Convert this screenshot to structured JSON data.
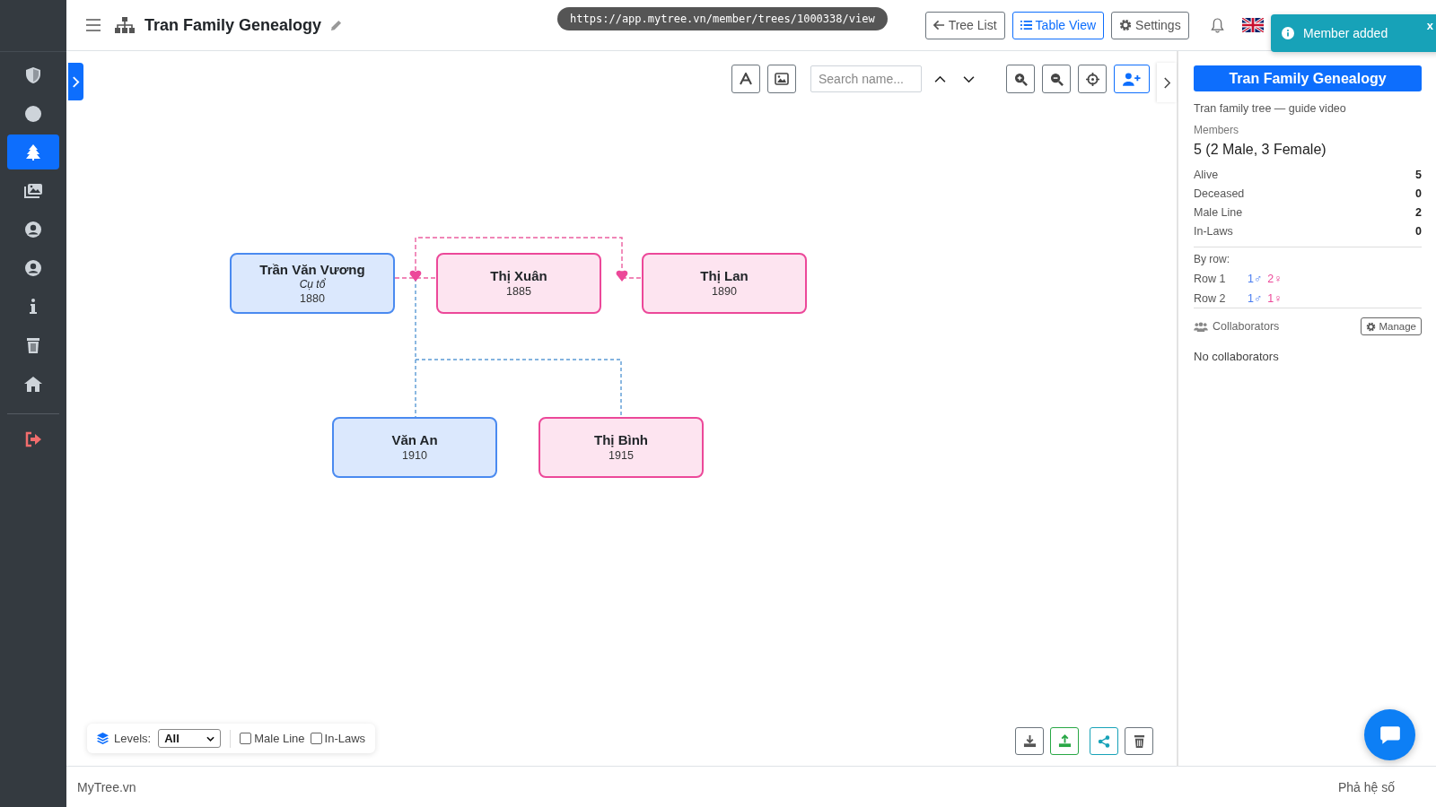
{
  "sidebar": {
    "items": [
      {
        "selected": false
      },
      {
        "selected": false
      },
      {
        "selected": true
      },
      {
        "selected": false
      },
      {
        "selected": false
      },
      {
        "selected": false
      },
      {
        "selected": false
      },
      {
        "selected": false
      },
      {
        "selected": false
      },
      {
        "selected": false
      }
    ]
  },
  "header": {
    "title": "Tran Family Genealogy",
    "url": "https://app.mytree.vn/member/trees/1000338/view",
    "buttons": [
      {
        "label": "Tree List",
        "selected": false
      },
      {
        "label": "Table View",
        "selected": true
      },
      {
        "label": "Settings",
        "selected": false
      }
    ]
  },
  "toast": {
    "message": "Member added",
    "close": "x"
  },
  "toolbar": {
    "search": {
      "placeholder": "Search name..."
    }
  },
  "tree": {
    "rows": [
      [
        {
          "name": "Trần Văn Vương",
          "note": "Cụ tổ",
          "year": "1880",
          "kind": "male"
        },
        {
          "name": "Thị Xuân",
          "year": "1885",
          "kind": "female"
        },
        {
          "name": "Thị Lan",
          "year": "1890",
          "kind": "female"
        }
      ],
      [
        {
          "name": "Văn An",
          "year": "1910",
          "kind": "male"
        },
        {
          "name": "Thị Bình",
          "year": "1915",
          "kind": "female"
        }
      ]
    ]
  },
  "filters": {
    "levels_label": "Levels:",
    "levels_value": "All",
    "checks": [
      {
        "label": "Male Line",
        "checked": false
      },
      {
        "label": "In-Laws",
        "checked": false
      }
    ]
  },
  "panel": {
    "title": "Tran Family Genealogy",
    "description": "Tran family tree — guide video",
    "members_label": "Members",
    "members_value": "5 (2 Male, 3 Female)",
    "stats": [
      {
        "label": "Alive",
        "value": "5"
      },
      {
        "label": "Deceased",
        "value": "0"
      },
      {
        "label": "Male Line",
        "value": "2"
      },
      {
        "label": "In-Laws",
        "value": "0"
      }
    ],
    "by_row_label": "By row:",
    "by_row": [
      {
        "label": "Row 1",
        "male": "1♂",
        "female": "2♀"
      },
      {
        "label": "Row 2",
        "male": "1♂",
        "female": "1♀"
      }
    ],
    "collaborators_label": "Collaborators",
    "manage": "Manage",
    "collaborators_empty": "No collaborators"
  },
  "footer": {
    "left": "MyTree.vn",
    "right": "Phả hệ số"
  }
}
